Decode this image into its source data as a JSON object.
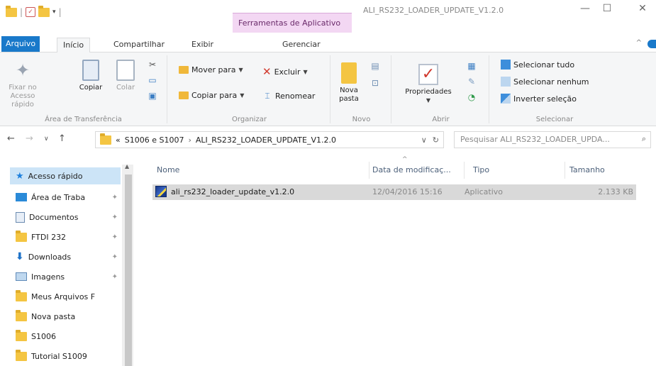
{
  "window": {
    "title": "ALI_RS232_LOADER_UPDATE_V1.2.0",
    "context_tab": "Ferramentas de Aplicativo"
  },
  "tabs": {
    "file": "Arquivo",
    "home": "Início",
    "share": "Compartilhar",
    "view": "Exibir",
    "manage": "Gerenciar"
  },
  "ribbon": {
    "clipboard": {
      "pin_label": "Fixar no Acesso rápido",
      "copy_label": "Copiar",
      "paste_label": "Colar",
      "group_label": "Área de Transferência"
    },
    "organize": {
      "move_to": "Mover para",
      "copy_to": "Copiar para",
      "delete": "Excluir",
      "rename": "Renomear",
      "group_label": "Organizar"
    },
    "new": {
      "new_folder": "Nova pasta",
      "group_label": "Novo"
    },
    "open": {
      "properties": "Propriedades",
      "group_label": "Abrir"
    },
    "select": {
      "select_all": "Selecionar tudo",
      "select_none": "Selecionar nenhum",
      "invert": "Inverter seleção",
      "group_label": "Selecionar"
    }
  },
  "address": {
    "overflow": "«",
    "segments": [
      "S1006 e S1007",
      "ALI_RS232_LOADER_UPDATE_V1.2.0"
    ],
    "search_placeholder": "Pesquisar ALI_RS232_LOADER_UPDA..."
  },
  "navpane": {
    "items": [
      {
        "label": "Acesso rápido",
        "icon": "star-icon"
      },
      {
        "label": "Área de Traba",
        "icon": "desktop-icon"
      },
      {
        "label": "Documentos",
        "icon": "documents-icon"
      },
      {
        "label": "FTDI 232",
        "icon": "folder-icon"
      },
      {
        "label": "Downloads",
        "icon": "download-icon"
      },
      {
        "label": "Imagens",
        "icon": "pictures-icon"
      },
      {
        "label": "Meus Arquivos F",
        "icon": "folder-icon"
      },
      {
        "label": "Nova pasta",
        "icon": "folder-icon"
      },
      {
        "label": "S1006",
        "icon": "folder-icon"
      },
      {
        "label": "Tutorial S1009",
        "icon": "folder-icon"
      }
    ]
  },
  "filelist": {
    "columns": [
      "Nome",
      "Data de modificaç...",
      "Tipo",
      "Tamanho"
    ],
    "rows": [
      {
        "name": "ali_rs232_loader_update_v1.2.0",
        "date": "12/04/2016 15:16",
        "type": "Aplicativo",
        "size": "2.133 KB"
      }
    ]
  },
  "colors": {
    "accent": "#1979ca",
    "context_tab": "#f3d7f3",
    "selection": "#cce4f7",
    "row_selected": "#d9d9d9"
  }
}
